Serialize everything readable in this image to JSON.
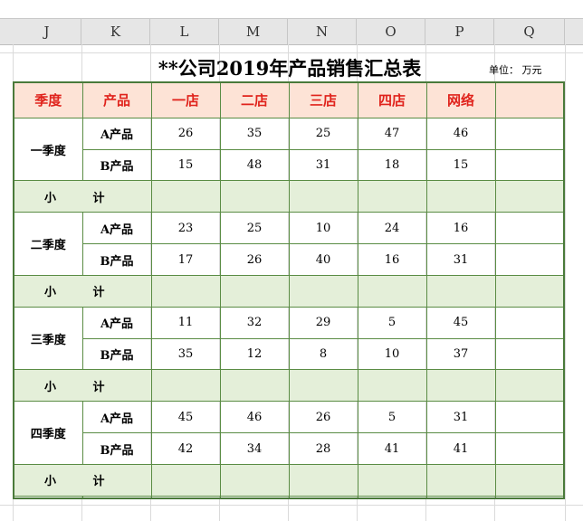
{
  "columns": [
    "J",
    "K",
    "L",
    "M",
    "N",
    "O",
    "P",
    "Q"
  ],
  "report": {
    "title": "**公司2019年产品销售汇总表",
    "unit": "单位：  万元",
    "header": {
      "season": "季度",
      "product": "产品",
      "stores": [
        "一店",
        "二店",
        "三店",
        "四店",
        "网络"
      ]
    },
    "quarters": [
      {
        "name": "一季度",
        "rows": [
          {
            "product": "A产品",
            "values": [
              "26",
              "35",
              "25",
              "47",
              "46"
            ]
          },
          {
            "product": "B产品",
            "values": [
              "15",
              "48",
              "31",
              "18",
              "15"
            ]
          }
        ],
        "subtotal": "小 计"
      },
      {
        "name": "二季度",
        "rows": [
          {
            "product": "A产品",
            "values": [
              "23",
              "25",
              "10",
              "24",
              "16"
            ]
          },
          {
            "product": "B产品",
            "values": [
              "17",
              "26",
              "40",
              "16",
              "31"
            ]
          }
        ],
        "subtotal": "小 计"
      },
      {
        "name": "三季度",
        "rows": [
          {
            "product": "A产品",
            "values": [
              "11",
              "32",
              "29",
              "5",
              "45"
            ]
          },
          {
            "product": "B产品",
            "values": [
              "35",
              "12",
              "8",
              "10",
              "37"
            ]
          }
        ],
        "subtotal": "小 计"
      },
      {
        "name": "四季度",
        "rows": [
          {
            "product": "A产品",
            "values": [
              "45",
              "46",
              "26",
              "5",
              "31"
            ]
          },
          {
            "product": "B产品",
            "values": [
              "42",
              "34",
              "28",
              "41",
              "41"
            ]
          }
        ],
        "subtotal": "小 计"
      }
    ]
  },
  "colors": {
    "header_fill": "#fde3d6",
    "header_text": "#e0231c",
    "subtotal_fill": "#e4efd9",
    "border": "#4a7a3a",
    "product_text": "#2f5c8e",
    "subtotal_text": "#b8420c"
  }
}
